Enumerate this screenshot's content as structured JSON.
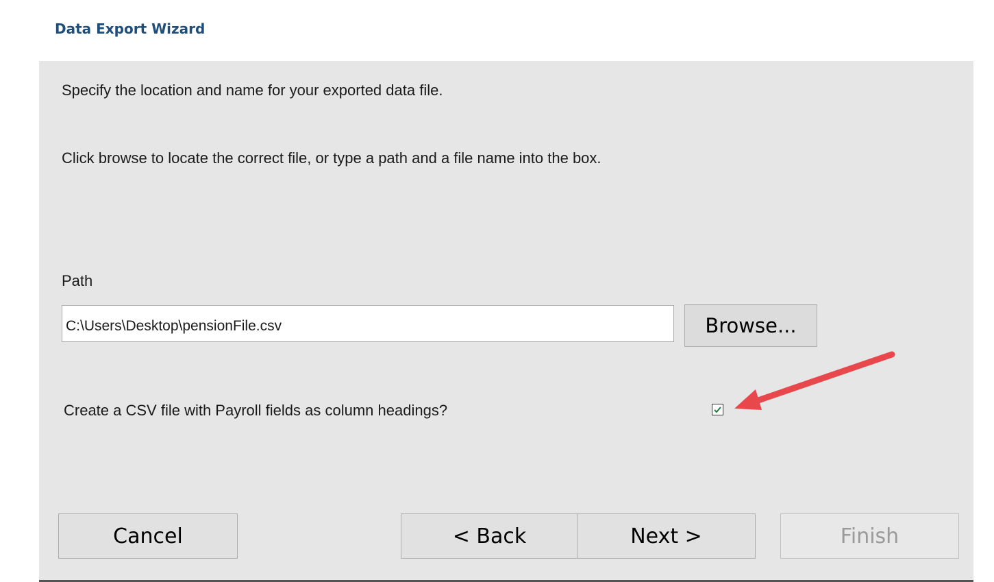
{
  "window": {
    "title": "Data Export Wizard"
  },
  "instructions": {
    "line1": "Specify the location and name for your exported data file.",
    "line2": "Click browse to locate the correct file, or type a path and a file name into the box."
  },
  "path": {
    "label": "Path",
    "value": "C:\\Users\\Desktop\\pensionFile.csv",
    "browse_label": "Browse..."
  },
  "csv_option": {
    "label": "Create a CSV file with Payroll fields as column headings?",
    "checked": true
  },
  "buttons": {
    "cancel": "Cancel",
    "back": "< Back",
    "next": "Next >",
    "finish": "Finish"
  },
  "colors": {
    "title": "#1e4e79",
    "panel_background": "#e6e6e6",
    "annotation_arrow": "#e8484b",
    "checkmark": "#1f7a3f"
  },
  "icons": {
    "checkbox_checkmark": "checkmark-icon",
    "annotation": "arrow-icon"
  }
}
